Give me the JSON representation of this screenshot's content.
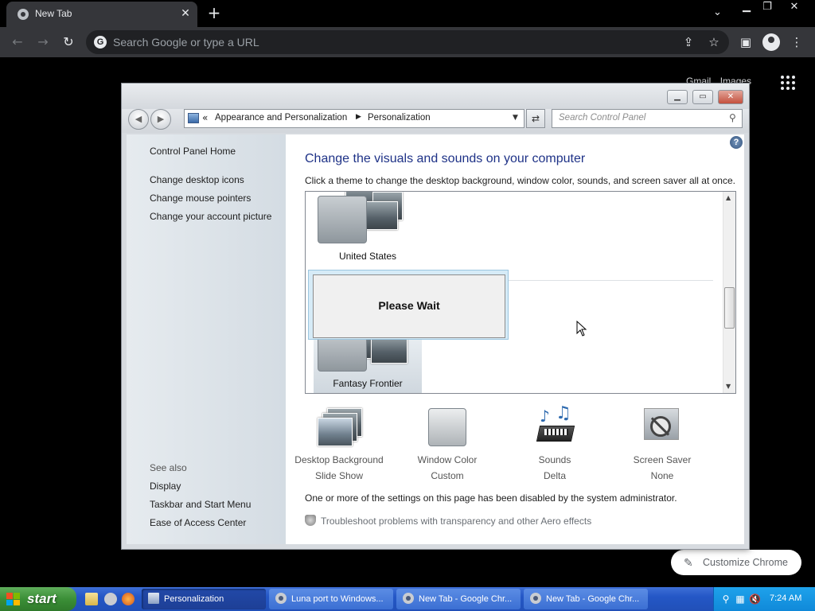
{
  "chrome": {
    "tab_title": "New Tab",
    "omnibox_placeholder": "Search Google or type a URL",
    "ntp_links": [
      "Gmail",
      "Images"
    ],
    "customize_label": "Customize Chrome",
    "icons": [
      "chrome-icon",
      "close-icon",
      "plus-icon",
      "chevron-down-icon",
      "minimize-icon",
      "restore-icon",
      "close-icon",
      "back-icon",
      "forward-icon",
      "reload-icon",
      "google-icon",
      "share-icon",
      "star-icon",
      "side-panel-icon",
      "profile-icon",
      "more-icon",
      "apps-icon",
      "pencil-icon"
    ]
  },
  "control_panel": {
    "breadcrumb": {
      "prefix": "«",
      "items": [
        "Appearance and Personalization",
        "Personalization"
      ]
    },
    "search_placeholder": "Search Control Panel",
    "left_links": {
      "home": "Control Panel Home",
      "tasks": [
        "Change desktop icons",
        "Change mouse pointers",
        "Change your account picture"
      ],
      "see_also_header": "See also",
      "see_also": [
        "Display",
        "Taskbar and Start Menu",
        "Ease of Access Center"
      ]
    },
    "main": {
      "title": "Change the visuals and sounds on your computer",
      "subtitle": "Click a theme to change the desktop background, window color, sounds, and screen saver all at once.",
      "themes": [
        "United States",
        "Fantasy Frontier"
      ],
      "please_wait": "Please Wait",
      "categories": [
        {
          "label": "Desktop Background",
          "value": "Slide Show"
        },
        {
          "label": "Window Color",
          "value": "Custom"
        },
        {
          "label": "Sounds",
          "value": "Delta"
        },
        {
          "label": "Screen Saver",
          "value": "None"
        }
      ],
      "disabled_message": "One or more of the settings on this page has been disabled by the system administrator.",
      "troubleshoot_link": "Troubleshoot problems with transparency and other Aero effects"
    }
  },
  "taskbar": {
    "start_label": "start",
    "tasks": [
      {
        "label": "Personalization",
        "active": true
      },
      {
        "label": "Luna port to Windows...",
        "active": false
      },
      {
        "label": "New Tab - Google Chr...",
        "active": false
      },
      {
        "label": "New Tab - Google Chr...",
        "active": false
      }
    ],
    "clock": "7:24 AM"
  },
  "colors": {
    "chrome_dark": "#35363a",
    "cp_title_blue": "#1e3287",
    "xp_taskbar": "#2457c6",
    "xp_start_green": "#3b8f37"
  }
}
